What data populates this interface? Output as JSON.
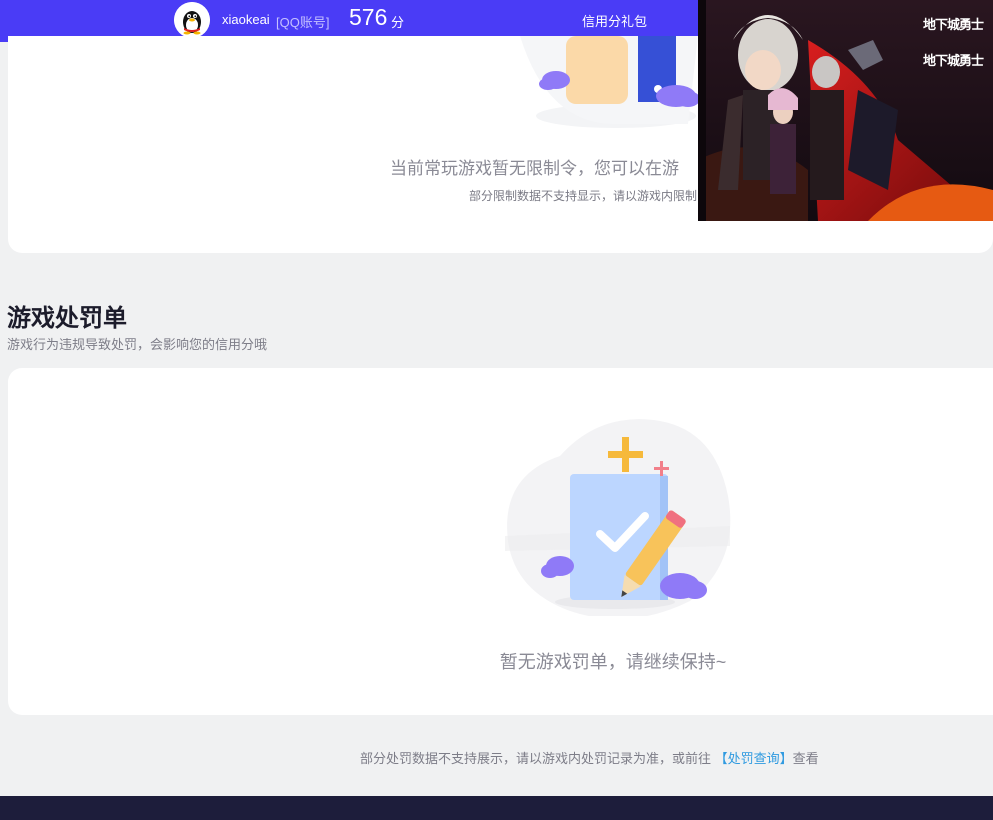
{
  "header": {
    "username": "xiaokeai",
    "account_type": "[QQ账号]",
    "score": "576",
    "score_unit": "分",
    "gift_link": "信用分礼包"
  },
  "restriction_card": {
    "message": "当前常玩游戏暂无限制令，您可以在游",
    "note": "部分限制数据不支持显示，请以游戏内限制"
  },
  "promo_banner": {
    "logo_text_1": "地下城勇士",
    "logo_text_2": "地下城勇士"
  },
  "penalty_section": {
    "title": "游戏处罚单",
    "subtitle": "游戏行为违规导致处罚，会影响您的信用分哦",
    "empty_message": "暂无游戏罚单，请继续保持~"
  },
  "footnote": {
    "text_before": "部分处罚数据不支持展示，请以游戏内处罚记录为准，或前往 ",
    "link_text": "【处罚查询】",
    "text_after": "查看"
  },
  "colors": {
    "brand": "#4a3cf6",
    "link": "#2f9ae0",
    "footer": "#1d1d3b"
  }
}
